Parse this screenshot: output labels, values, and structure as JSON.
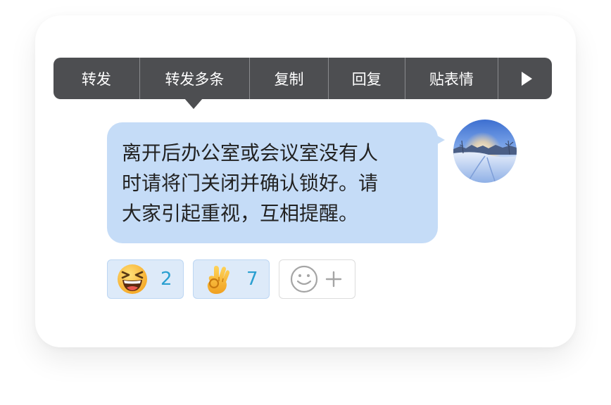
{
  "menu": {
    "items": [
      {
        "label": "转发"
      },
      {
        "label": "转发多条"
      },
      {
        "label": "复制"
      },
      {
        "label": "回复"
      },
      {
        "label": "贴表情"
      }
    ],
    "more_icon": "play-triangle-icon"
  },
  "message": {
    "lines": [
      "离开后办公室或会议室没有人",
      "时请将门关闭并确认锁好。请",
      "大家引起重视，互相提醒。"
    ],
    "bubble_color": "#c5dcf7"
  },
  "avatar": {
    "icon": "snowy-landscape-avatar"
  },
  "reactions": [
    {
      "emoji": "laughing-face-emoji",
      "count": "2"
    },
    {
      "emoji": "ok-hand-emoji",
      "count": "7"
    },
    {
      "emoji": "add-reaction-icon"
    }
  ],
  "colors": {
    "menu_bg": "#4d4e51",
    "count_color": "#2a9fd0",
    "reaction_bg": "#ddeaf9"
  }
}
